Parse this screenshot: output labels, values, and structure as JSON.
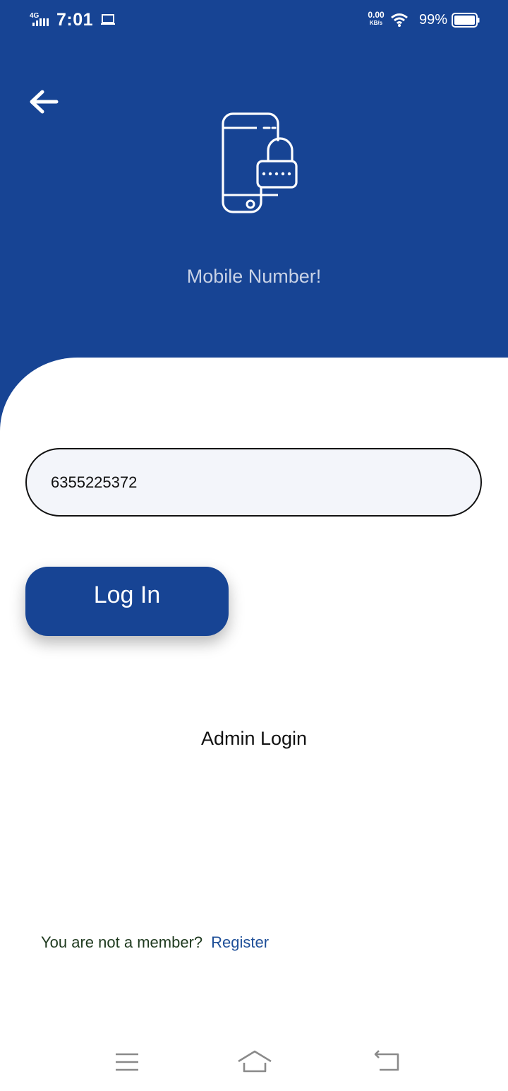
{
  "status_bar": {
    "network": "4G",
    "time": "7:01",
    "speed_value": "0.00",
    "speed_unit": "KB/s",
    "battery_percent": "99%",
    "icons": [
      "signal-icon",
      "laptop-icon",
      "wifi-icon",
      "battery-icon"
    ]
  },
  "header": {
    "title": "Mobile Number!",
    "illustration": "phone-lock-icon",
    "back_icon": "arrow-left-icon"
  },
  "form": {
    "phone_value": "6355225372",
    "login_label": "Log In"
  },
  "links": {
    "admin_login": "Admin Login",
    "member_prompt": "You are not a member?",
    "register": "Register"
  },
  "nav_bar": {
    "icons": [
      "menu-icon",
      "home-icon",
      "back-icon"
    ]
  },
  "colors": {
    "primary": "#174494",
    "link": "#1e4f98",
    "input_bg": "#f3f5fa"
  }
}
